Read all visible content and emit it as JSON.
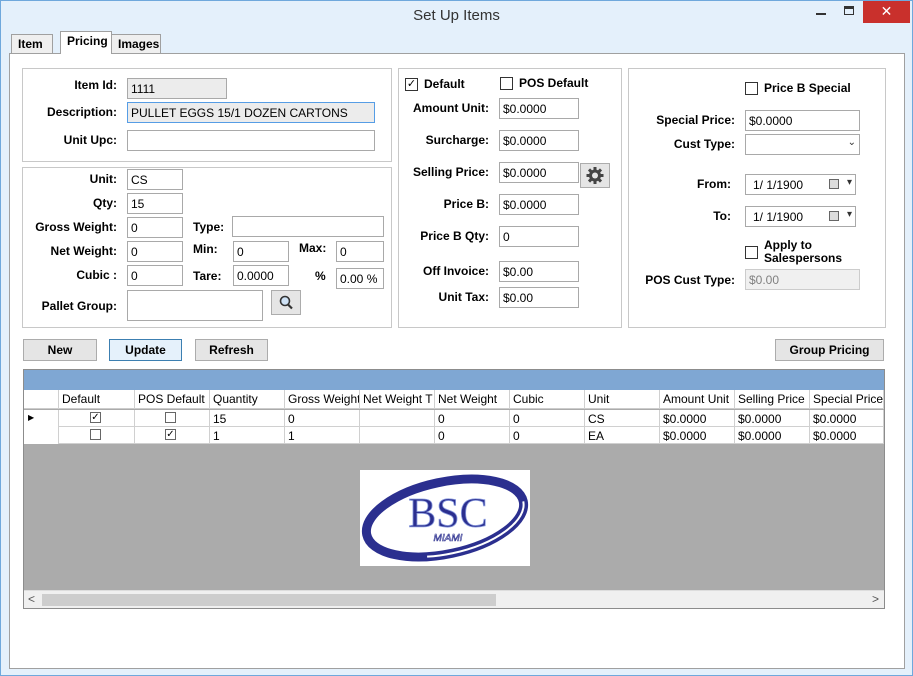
{
  "window": {
    "title": "Set Up Items",
    "min_glyph": "",
    "max_glyph": "",
    "close_glyph": "✕"
  },
  "tabs": [
    {
      "label": "Item"
    },
    {
      "label": "Pricing"
    },
    {
      "label": "Images"
    }
  ],
  "item": {
    "item_id_label": "Item Id:",
    "item_id": "1111",
    "description_label": "Description:",
    "description": "PULLET EGGS 15/1 DOZEN CARTONS",
    "unit_upc_label": "Unit Upc:",
    "unit_upc": ""
  },
  "units": {
    "unit_label": "Unit:",
    "unit": "CS",
    "qty_label": "Qty:",
    "qty": "15",
    "gross_weight_label": "Gross Weight:",
    "gross_weight": "0",
    "type_label": "Type:",
    "type": "",
    "net_weight_label": "Net Weight:",
    "net_weight": "0",
    "min_label": "Min:",
    "min": "0",
    "max_label": "Max:",
    "max": "0",
    "cubic_label": "Cubic :",
    "cubic": "0",
    "tare_label": "Tare:",
    "tare": "0.0000",
    "pct_label": "%",
    "pct": "0.00 %",
    "pallet_group_label": "Pallet Group:",
    "pallet_group": ""
  },
  "pricing": {
    "default_label": "Default",
    "default_checked": "✓",
    "pos_default_label": "POS Default",
    "pos_default_checked": "",
    "amount_unit_label": "Amount Unit:",
    "amount_unit": "$0.0000",
    "surcharge_label": "Surcharge:",
    "surcharge": "$0.0000",
    "selling_price_label": "Selling Price:",
    "selling_price": "$0.0000",
    "price_b_label": "Price B:",
    "price_b": "$0.0000",
    "price_b_qty_label": "Price B Qty:",
    "price_b_qty": "0",
    "off_invoice_label": "Off Invoice:",
    "off_invoice": "$0.00",
    "unit_tax_label": "Unit Tax:",
    "unit_tax": "$0.00"
  },
  "special": {
    "price_b_special_label": "Price B Special",
    "price_b_special_checked": "",
    "special_price_label": "Special Price:",
    "special_price": "$0.0000",
    "cust_type_label": "Cust Type:",
    "cust_type": "",
    "from_label": "From:",
    "from": "1/ 1/1900",
    "to_label": "To:",
    "to": "1/ 1/1900",
    "apply_label_1": "Apply to",
    "apply_label_2": "Salespersons",
    "apply_checked": "",
    "pos_cust_type_label": "POS Cust Type:",
    "pos_cust_type": "$0.00"
  },
  "buttons": {
    "new": "New",
    "update": "Update",
    "refresh": "Refresh",
    "group_pricing": "Group Pricing"
  },
  "grid": {
    "columns": [
      "Default",
      "POS Default",
      "Quantity",
      "Gross Weight",
      "Net Weight T",
      "Net Weight",
      "Cubic",
      "Unit",
      "Amount Unit",
      "Selling Price",
      "Special Price"
    ],
    "rows": [
      {
        "current": "▶",
        "default": "✓",
        "pos_default": "",
        "quantity": "15",
        "gross_weight": "0",
        "net_weight_t": "",
        "net_weight": "0",
        "cubic": "0",
        "unit": "CS",
        "amount_unit": "$0.0000",
        "selling_price": "$0.0000",
        "special_price": "$0.0000"
      },
      {
        "current": "",
        "default": "",
        "pos_default": "✓",
        "quantity": "1",
        "gross_weight": "1",
        "net_weight_t": "",
        "net_weight": "0",
        "cubic": "0",
        "unit": "EA",
        "amount_unit": "$0.0000",
        "selling_price": "$0.0000",
        "special_price": "$0.0000"
      }
    ],
    "scroll_left": "<",
    "scroll_right": ">"
  },
  "logo": {
    "text": "BSC",
    "subtext": "MIAMI",
    "color": "#2b2f8f"
  },
  "colors": {
    "accent": "#3c7fb1",
    "grid_band": "#7fa7d3",
    "close": "#c9302c"
  }
}
